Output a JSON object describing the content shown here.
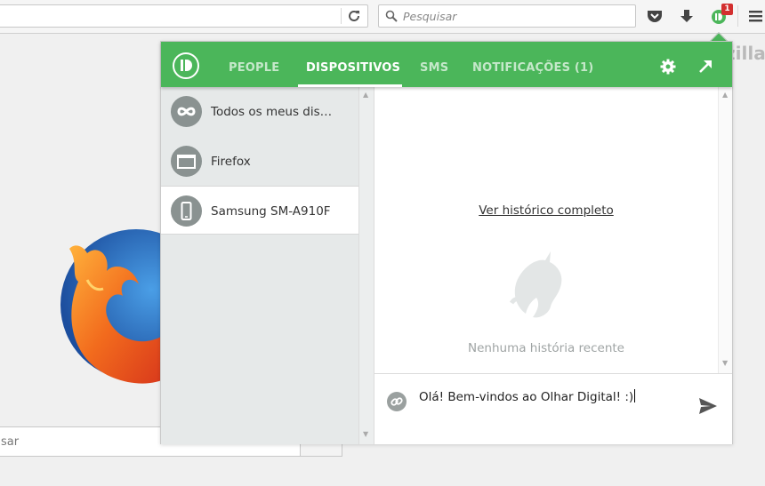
{
  "browser": {
    "search_placeholder": "Pesquisar",
    "badge_count": "1",
    "page_brand_partial": "zilla",
    "page_search_partial": "sar"
  },
  "popup": {
    "tabs": [
      {
        "label": "PEOPLE",
        "active": false
      },
      {
        "label": "DISPOSITIVOS",
        "active": true
      },
      {
        "label": "SMS",
        "active": false
      },
      {
        "label": "NOTIFICAÇÕES (1)",
        "active": false
      }
    ],
    "devices": [
      {
        "label": "Todos os meus dis…",
        "icon": "infinity-icon"
      },
      {
        "label": "Firefox",
        "icon": "browser-window-icon"
      },
      {
        "label": "Samsung SM-A910F",
        "icon": "phone-icon",
        "selected": true
      }
    ],
    "history_link": "Ver histórico completo",
    "empty_state": "Nenhuma história recente",
    "message_value": "Olá! Bem-vindos ao Olhar Digital! :)"
  },
  "colors": {
    "accent": "#4bb65a",
    "badge": "#d32f2f"
  }
}
